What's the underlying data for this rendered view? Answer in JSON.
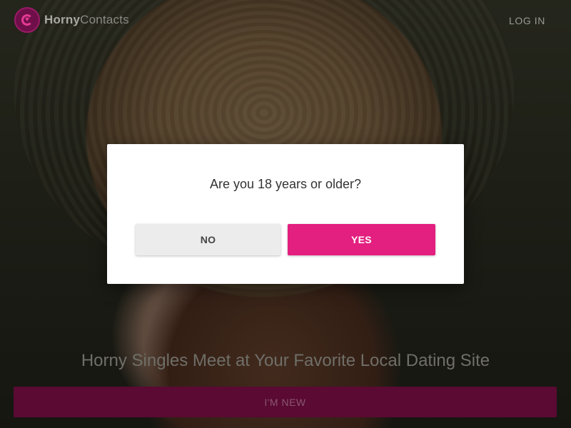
{
  "header": {
    "logo_bold": "Horny",
    "logo_light": "Contacts",
    "login_label": "LOG IN"
  },
  "hero": {
    "tagline": "Horny Singles Meet at Your Favorite Local Dating Site",
    "cta_label": "I'M NEW"
  },
  "modal": {
    "question": "Are you 18 years or older?",
    "no_label": "NO",
    "yes_label": "YES"
  },
  "colors": {
    "brand": "#e31f7f",
    "brand_dark": "#5a0a33",
    "overlay": "rgba(0,0,0,0.52)"
  },
  "icons": {
    "logo": "heart-logo-icon"
  }
}
